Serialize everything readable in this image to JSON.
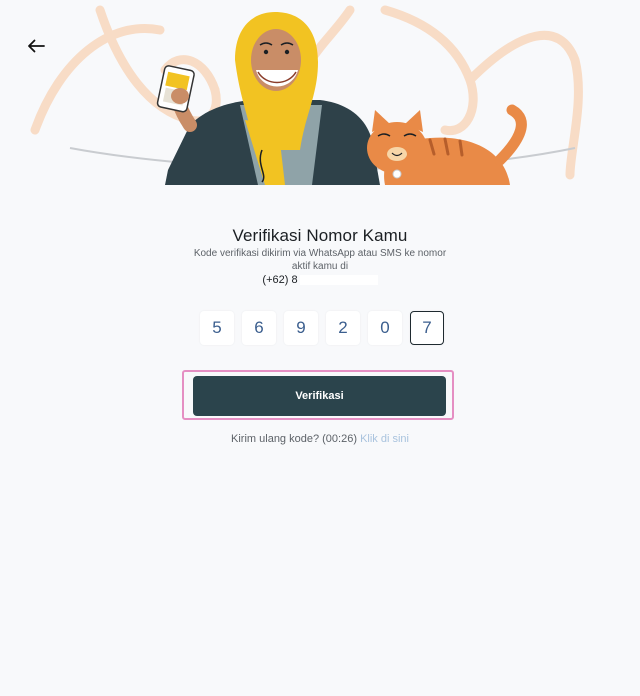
{
  "header": {
    "back_icon": "arrow-left-icon"
  },
  "hero": {
    "illustration": "woman-hijab-phone-and-cat-illustration",
    "colors": {
      "hijab": "#f2c322",
      "jacket": "#2e4149",
      "cat": "#e98a47",
      "swirl": "#f8dcc6"
    }
  },
  "verification": {
    "title": "Verifikasi Nomor Kamu",
    "subtitle": "Kode verifikasi dikirim via WhatsApp atau SMS ke nomor aktif kamu di",
    "phone_prefix": "(+62) 8"
  },
  "otp": {
    "digits": [
      "5",
      "6",
      "9",
      "2",
      "0",
      "7"
    ],
    "active_index": 5
  },
  "actions": {
    "verify_label": "Verifikasi"
  },
  "resend": {
    "text": "Kirim ulang kode? (00:26)",
    "link_label": "Klik di sini"
  },
  "colors": {
    "background": "#f8f9fb",
    "button": "#2b444c",
    "highlight": "#e58fc3",
    "link": "#a9c3de",
    "digit": "#3b5e8e"
  }
}
